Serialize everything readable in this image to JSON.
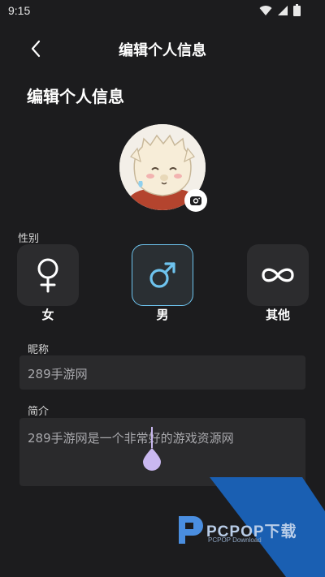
{
  "status_bar": {
    "time": "9:15"
  },
  "nav": {
    "title": "编辑个人信息"
  },
  "page": {
    "heading": "编辑个人信息"
  },
  "gender": {
    "label": "性别",
    "options": [
      {
        "label": "女",
        "icon": "female-icon"
      },
      {
        "label": "男",
        "icon": "male-icon"
      },
      {
        "label": "其他",
        "icon": "infinity-icon"
      }
    ],
    "selected": "男",
    "accent": "#6ec3ee"
  },
  "nickname": {
    "label": "昵称",
    "value": "289手游网"
  },
  "bio": {
    "label": "简介",
    "value": "289手游网是一个非常好的游戏资源网"
  },
  "watermark": {
    "brand": "PCPOP下载",
    "sub": "PCPOP Download"
  },
  "colors": {
    "background": "#1c1c1e",
    "card": "#2c2c2e",
    "field": "#2a2a2c",
    "handle": "#c9b8f0"
  }
}
